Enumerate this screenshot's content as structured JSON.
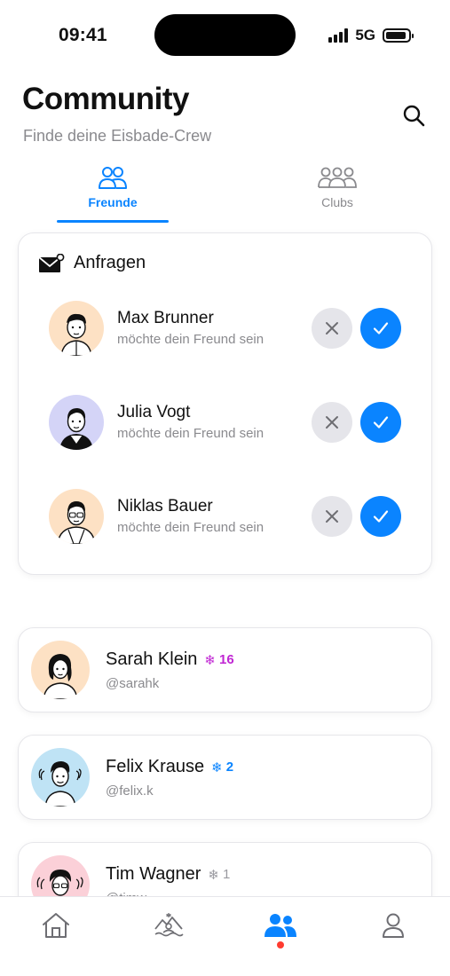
{
  "status_bar": {
    "time": "09:41",
    "network": "5G",
    "battery_level": 0.9
  },
  "header": {
    "title": "Community",
    "subtitle": "Finde deine Eisbade-Crew",
    "search_icon": "search-icon"
  },
  "tabs": [
    {
      "label": "Freunde",
      "icon": "friends-icon",
      "active": true
    },
    {
      "label": "Clubs",
      "icon": "clubs-icon",
      "active": false
    }
  ],
  "requests": {
    "title": "Anfragen",
    "icon": "mail-icon",
    "items": [
      {
        "name": "Max Brunner",
        "message": "möchte dein Freund sein",
        "avatar_bg": "#fde1c4"
      },
      {
        "name": "Julia Vogt",
        "message": "möchte dein Freund sein",
        "avatar_bg": "#d4d4f7"
      },
      {
        "name": "Niklas Bauer",
        "message": "möchte dein Freund sein",
        "avatar_bg": "#fde1c4"
      }
    ]
  },
  "friends": [
    {
      "name": "Sarah Klein",
      "handle": "@sarahk",
      "streak": "16",
      "streak_color": "#c026d3",
      "avatar_bg": "#fde1c4"
    },
    {
      "name": "Felix Krause",
      "handle": "@felix.k",
      "streak": "2",
      "streak_color": "#0a84ff",
      "avatar_bg": "#bfe3f5"
    },
    {
      "name": "Tim Wagner",
      "handle": "@timw",
      "streak": "1",
      "streak_color": "#9a9aa0",
      "avatar_bg": "#fbd0d8"
    }
  ],
  "bottom_nav": [
    {
      "name": "home",
      "icon": "home-icon",
      "active": false
    },
    {
      "name": "spots",
      "icon": "ice-bath-icon",
      "active": false
    },
    {
      "name": "community",
      "icon": "community-icon",
      "active": true,
      "notification": true
    },
    {
      "name": "profile",
      "icon": "profile-icon",
      "active": false
    }
  ],
  "colors": {
    "accent": "#0a84ff",
    "decline_bg": "#e5e5ea",
    "notification": "#ff3b30",
    "secondary_text": "#8a8a8e"
  }
}
